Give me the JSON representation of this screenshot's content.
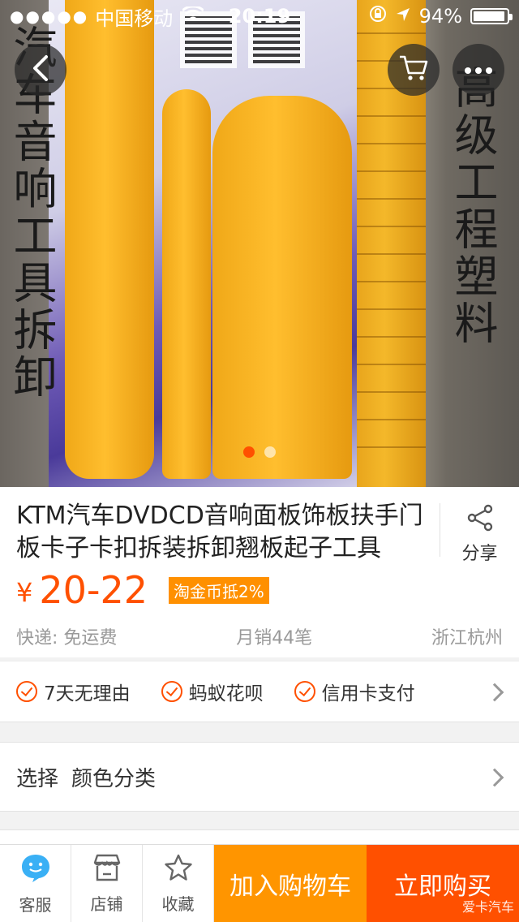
{
  "status_bar": {
    "signal": "●●●●●",
    "carrier": "中国移动",
    "time": "20:19",
    "battery": "94%"
  },
  "hero": {
    "caption_left": "汽车音响工具拆卸",
    "caption_right": "高级工程塑料",
    "pager": {
      "count": 2,
      "active_index": 0
    }
  },
  "product": {
    "title": "KTM汽车DVDCD音响面板饰板扶手门板卡子卡扣拆装拆卸翘板起子工具",
    "share_label": "分享",
    "currency": "¥",
    "price": "20-22",
    "promo_tag": "淘金币抵2%",
    "shipping": "快递: 免运费",
    "monthly_sales": "月销44笔",
    "location": "浙江杭州"
  },
  "services": [
    {
      "label": "7天无理由"
    },
    {
      "label": "蚂蚁花呗"
    },
    {
      "label": "信用卡支付"
    }
  ],
  "select_row": {
    "label": "选择",
    "value": "颜色分类"
  },
  "bottom_bar": {
    "tabs": [
      {
        "label": "客服",
        "icon": "customer-service-icon"
      },
      {
        "label": "店铺",
        "icon": "shop-icon"
      },
      {
        "label": "收藏",
        "icon": "star-icon"
      }
    ],
    "add_to_cart": "加入购物车",
    "buy_now": "立即购买"
  },
  "watermark": "爱卡汽车",
  "colors": {
    "accent": "#ff5000",
    "cart_button": "#ff9500",
    "promo_tag": "#ff9000"
  }
}
